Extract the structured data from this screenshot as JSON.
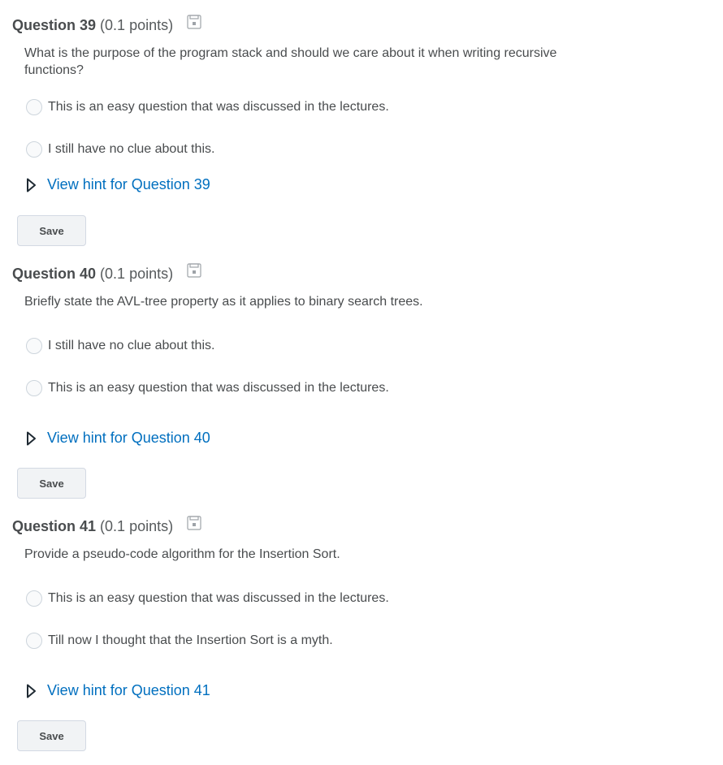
{
  "questions": [
    {
      "title": "Question 39",
      "points": "(0.1 points)",
      "text": "What is the purpose of the program stack and should we care about it when writing recursive functions?",
      "options": [
        "This is an easy question that was discussed in the lectures.",
        "I still have no clue about this."
      ],
      "hint": "View hint for Question 39",
      "save": "Save"
    },
    {
      "title": "Question 40",
      "points": "(0.1 points)",
      "text": "Briefly state the AVL-tree property as it applies to binary search trees.",
      "options": [
        "I still have no clue about this.",
        "This is an easy question that was discussed in the lectures."
      ],
      "hint": "View hint for Question 40",
      "save": "Save"
    },
    {
      "title": "Question 41",
      "points": "(0.1 points)",
      "text": "Provide a pseudo-code algorithm for the Insertion Sort.",
      "options": [
        "This is an easy question that was discussed in the lectures.",
        "Till now I thought that the Insertion Sort is a myth."
      ],
      "hint": "View hint for Question 41",
      "save": "Save"
    }
  ],
  "colors": {
    "text": "#494c4e",
    "link": "#006fbf",
    "button_bg": "#f1f3f5",
    "button_border": "#d3d9e3",
    "radio_border": "#cdd5dc"
  },
  "icons": {
    "save_status": "floppy-disk-icon",
    "hint_toggle": "triangle-right-outline-icon"
  }
}
